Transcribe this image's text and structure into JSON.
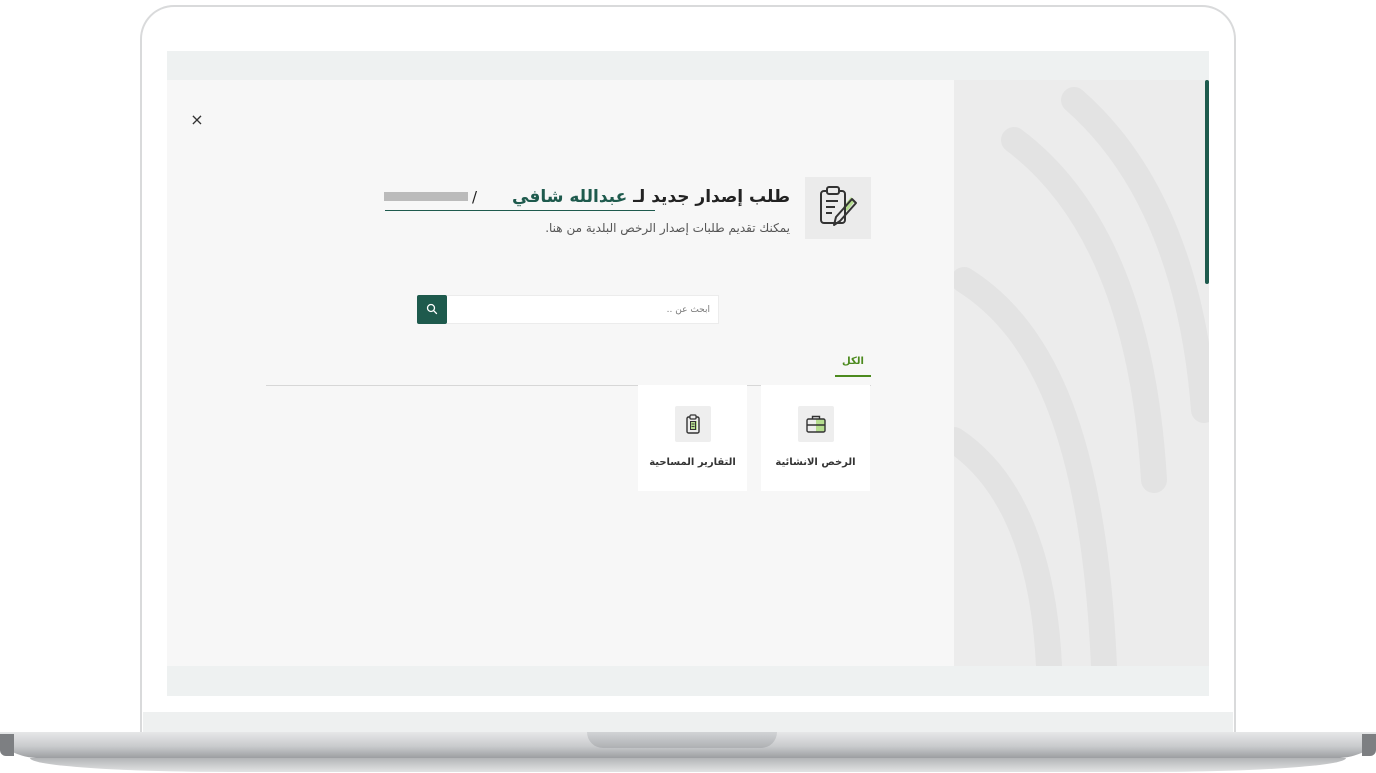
{
  "header": {
    "title_prefix": "طلب إصدار جديد لـ",
    "user_name": "عبدالله شافي",
    "separator": "/",
    "subtitle": "يمكنك تقديم طلبات إصدار الرخص البلدية من هنا."
  },
  "modal": {
    "close_symbol": "×"
  },
  "search": {
    "placeholder": "ابحث عن .."
  },
  "tabs": [
    {
      "label": "الكل",
      "active": true
    }
  ],
  "cards": [
    {
      "label": "الرخص الانشائية",
      "icon": "briefcase-icon"
    },
    {
      "label": "التقارير المساحية",
      "icon": "report-clipboard-icon"
    }
  ],
  "colors": {
    "primary": "#1e5a4d",
    "accent_green": "#4c8a1e",
    "icon_highlight": "#b5dd8f"
  }
}
